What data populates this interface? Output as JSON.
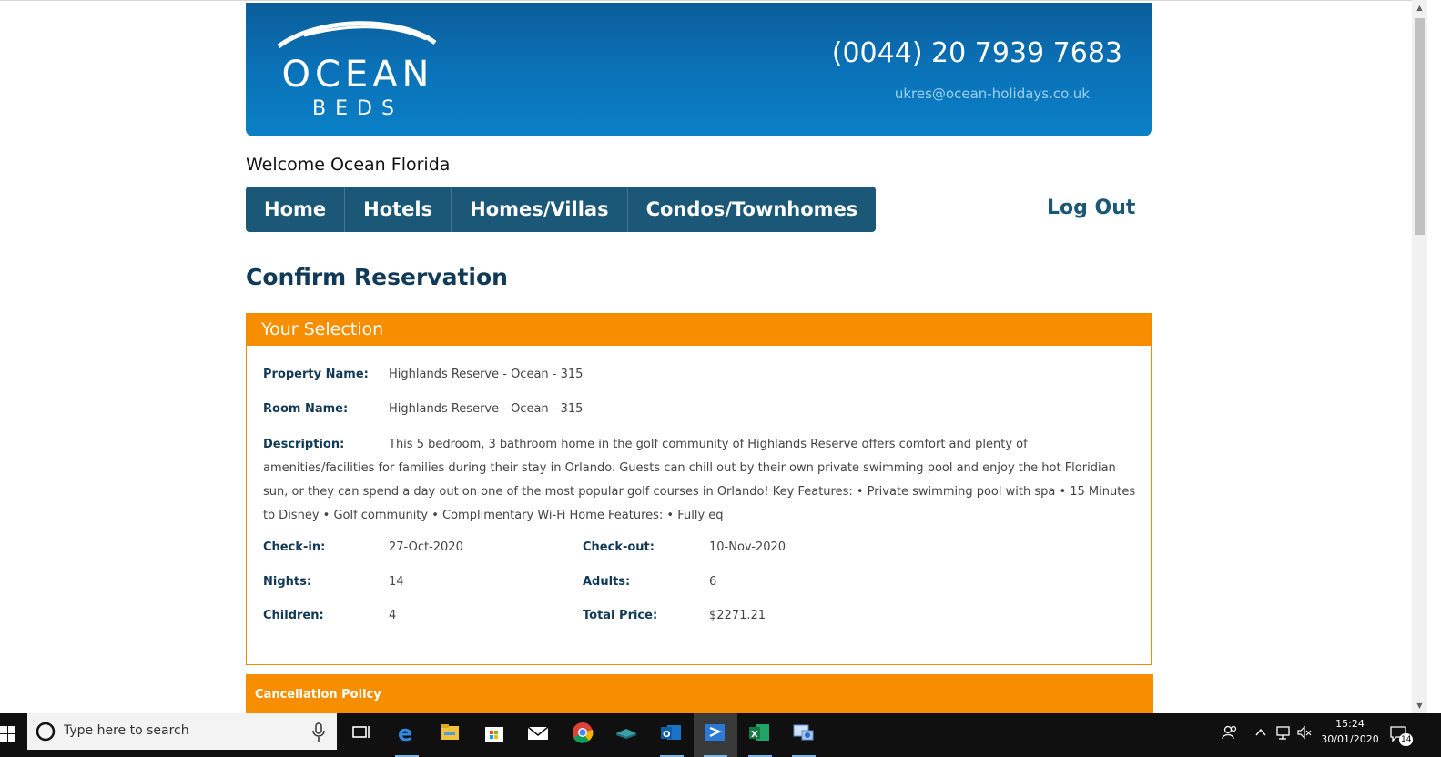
{
  "header": {
    "logo_top": "OCEAN",
    "logo_bottom": "BEDS",
    "phone": "(0044) 20 7939 7683",
    "email": "ukres@ocean-holidays.co.uk"
  },
  "welcome": "Welcome Ocean Florida",
  "nav": {
    "items": [
      {
        "label": "Home"
      },
      {
        "label": "Hotels"
      },
      {
        "label": "Homes/Villas"
      },
      {
        "label": "Condos/Townhomes"
      }
    ],
    "logout": "Log Out"
  },
  "page_title": "Confirm Reservation",
  "selection": {
    "heading": "Your Selection",
    "property_label": "Property Name:",
    "property_value": "Highlands Reserve - Ocean - 315",
    "room_label": "Room Name:",
    "room_value": "Highlands Reserve - Ocean - 315",
    "description_label": "Description:",
    "description_value": "This 5 bedroom, 3 bathroom home in the golf community of Highlands Reserve offers comfort and plenty of amenities/facilities for families during their stay in Orlando. Guests can chill out by their own private swimming pool and enjoy the hot Floridian sun, or they can spend a day out on one of the most popular golf courses in Orlando! Key Features: • Private swimming pool with spa • 15 Minutes to Disney • Golf community • Complimentary Wi-Fi Home Features: • Fully eq",
    "checkin_label": "Check-in:",
    "checkin_value": "27-Oct-2020",
    "checkout_label": "Check-out:",
    "checkout_value": "10-Nov-2020",
    "nights_label": "Nights:",
    "nights_value": "14",
    "adults_label": "Adults:",
    "adults_value": "6",
    "children_label": "Children:",
    "children_value": "4",
    "total_label": "Total Price:",
    "total_value": "$2271.21"
  },
  "cancellation": {
    "heading": "Cancellation Policy"
  },
  "taskbar": {
    "search_placeholder": "Type here to search",
    "time": "15:24",
    "date": "30/01/2020",
    "notification_count": "14",
    "pinned_icons": [
      "task-view-icon",
      "edge-icon",
      "file-explorer-icon",
      "store-icon",
      "mail-icon",
      "chrome-icon",
      "app-icon",
      "outlook-icon",
      "remote-desktop-icon",
      "excel-icon",
      "network-app-icon"
    ]
  },
  "colors": {
    "banner_blue": "#0a72b8",
    "nav_blue": "#1b5878",
    "orange": "#f78e00",
    "title_navy": "#113a58"
  }
}
